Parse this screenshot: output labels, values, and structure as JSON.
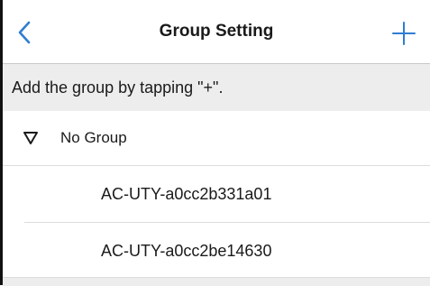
{
  "nav": {
    "title": "Group Setting",
    "back_icon": "chevron-left-icon",
    "add_icon": "plus-icon",
    "accent_color": "#2f7dd1"
  },
  "hint": {
    "text": "Add the group by tapping \"+\"."
  },
  "group": {
    "label": "No Group",
    "expand_icon": "triangle-down-icon",
    "devices": [
      {
        "label": "AC-UTY-a0cc2b331a01"
      },
      {
        "label": "AC-UTY-a0cc2be14630"
      }
    ]
  }
}
